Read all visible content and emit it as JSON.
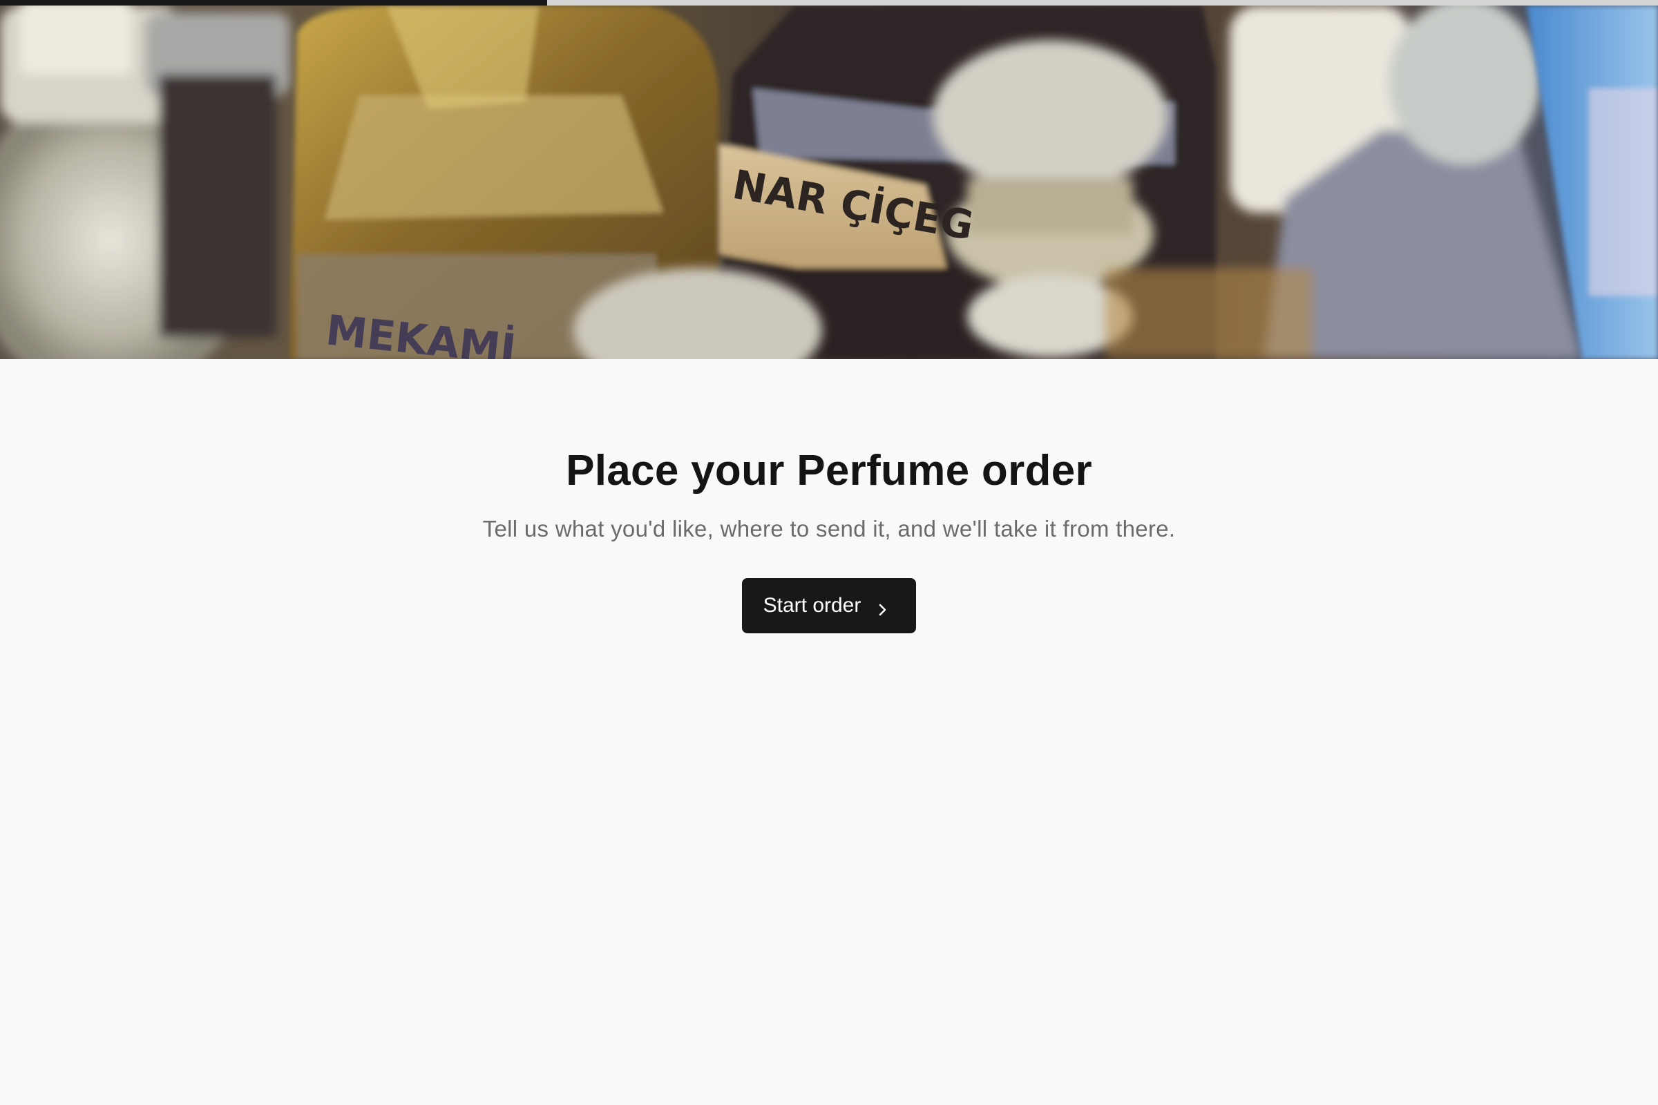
{
  "progress": {
    "fraction": 0.33,
    "track_color": "#d6d6d6",
    "fill_color": "#17171a"
  },
  "hero": {
    "image_description_name": "perfume-bottles-photo",
    "label_texts": [
      "NAR ÇİÇEG",
      "MEKAMİ"
    ]
  },
  "main": {
    "title": "Place your Perfume order",
    "subtitle": "Tell us what you'd like, where to send it, and we'll take it from there.",
    "start_button_label": "Start order",
    "start_button_icon": "chevron-right-icon"
  },
  "colors": {
    "background": "#f9f9f9",
    "title": "#141414",
    "subtitle": "#6b6b6b",
    "button_bg": "#18181b",
    "button_text": "#ffffff"
  }
}
